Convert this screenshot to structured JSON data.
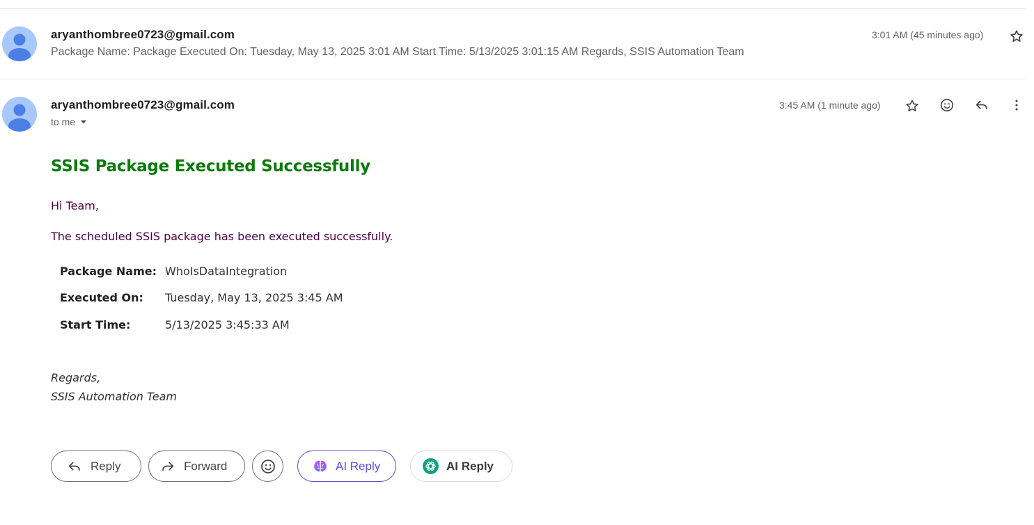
{
  "message1": {
    "sender": "aryanthombree0723@gmail.com",
    "snippet": "Package Name: Package Executed On: Tuesday, May 13, 2025 3:01 AM Start Time: 5/13/2025 3:01:15 AM Regards, SSIS Automation Team",
    "time": "3:01 AM (45 minutes ago)"
  },
  "message2": {
    "sender": "aryanthombree0723@gmail.com",
    "recipient": "to me",
    "time": "3:45 AM (1 minute ago)",
    "heading": "SSIS Package Executed Successfully",
    "greeting": "Hi Team,",
    "intro": "The scheduled SSIS package has been executed successfully.",
    "details": [
      {
        "label": "Package Name:",
        "value": "WhoIsDataIntegration"
      },
      {
        "label": "Executed On:",
        "value": "Tuesday, May 13, 2025 3:45 AM"
      },
      {
        "label": "Start Time:",
        "value": "5/13/2025 3:45:33 AM"
      }
    ],
    "signature_line1": "Regards,",
    "signature_line2": "SSIS Automation Team"
  },
  "actions": {
    "reply": "Reply",
    "forward": "Forward",
    "ai_reply_1": "AI Reply",
    "ai_reply_2": "AI Reply"
  },
  "icons": {
    "avatar": "person-avatar-icon",
    "star": "star-icon",
    "emoji": "emoji-icon",
    "reply": "reply-icon",
    "forward": "forward-icon",
    "more": "more-vert-icon",
    "dropdown": "caret-down-icon",
    "ai1": "ai-brain-icon",
    "ai2": "openai-icon"
  },
  "colors": {
    "heading": "#0b7a0b",
    "body_text": "#4a0049",
    "ai_accent": "#5b4ce6",
    "avatar_bg": "#a8c7fa",
    "avatar_fg": "#4a7fe6"
  }
}
